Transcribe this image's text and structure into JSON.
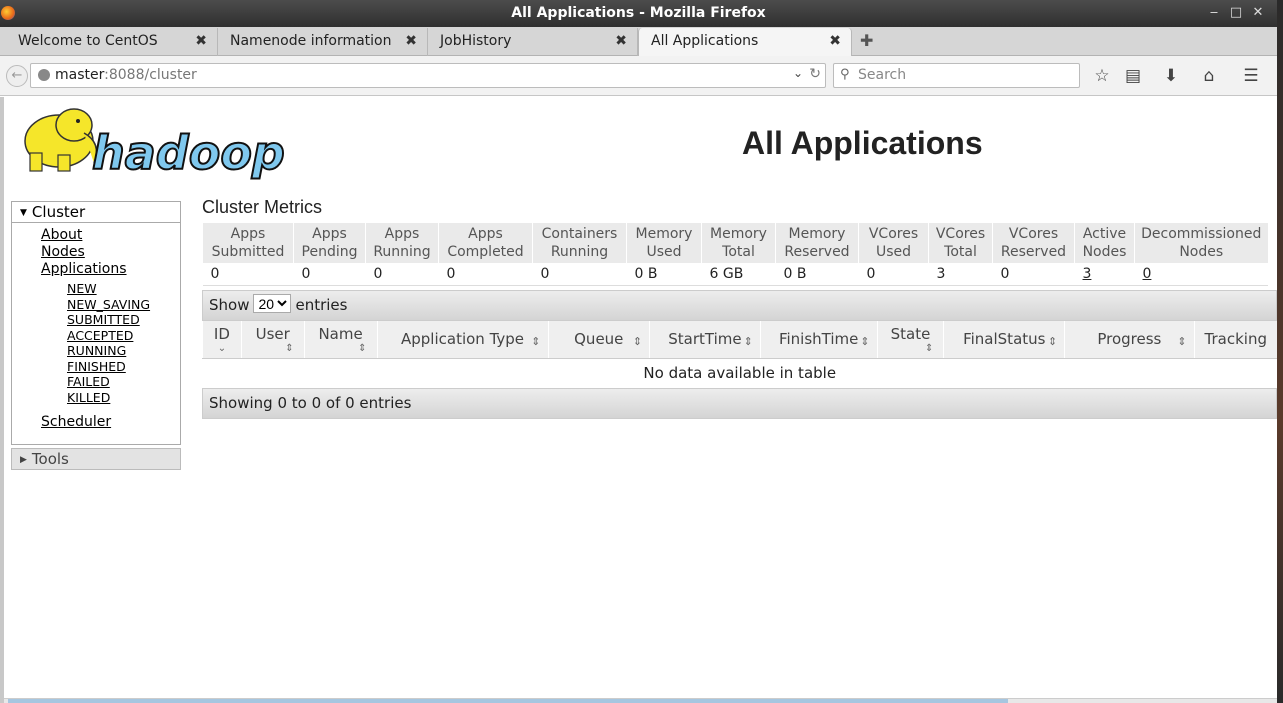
{
  "window": {
    "title": "All Applications - Mozilla Firefox"
  },
  "tabs": [
    {
      "label": "Welcome to CentOS"
    },
    {
      "label": "Namenode information"
    },
    {
      "label": "JobHistory"
    },
    {
      "label": "All Applications"
    }
  ],
  "nav": {
    "url_host": "master",
    "url_rest": ":8088/cluster",
    "search_placeholder": "Search"
  },
  "page": {
    "title": "All Applications"
  },
  "sidebar": {
    "cluster_label": "Cluster",
    "links": {
      "about": "About",
      "nodes": "Nodes",
      "applications": "Applications",
      "scheduler": "Scheduler"
    },
    "app_states": [
      "NEW",
      "NEW_SAVING",
      "SUBMITTED",
      "ACCEPTED",
      "RUNNING",
      "FINISHED",
      "FAILED",
      "KILLED"
    ],
    "tools_label": "Tools"
  },
  "metrics": {
    "title": "Cluster Metrics",
    "headers": [
      [
        "Apps",
        "Submitted"
      ],
      [
        "Apps",
        "Pending"
      ],
      [
        "Apps",
        "Running"
      ],
      [
        "Apps",
        "Completed"
      ],
      [
        "Containers",
        "Running"
      ],
      [
        "Memory",
        "Used"
      ],
      [
        "Memory",
        "Total"
      ],
      [
        "Memory",
        "Reserved"
      ],
      [
        "VCores",
        "Used"
      ],
      [
        "VCores",
        "Total"
      ],
      [
        "VCores",
        "Reserved"
      ],
      [
        "Active",
        "Nodes"
      ],
      [
        "Decommissioned",
        "Nodes"
      ]
    ],
    "values": [
      "0",
      "0",
      "0",
      "0",
      "0",
      "0 B",
      "6 GB",
      "0 B",
      "0",
      "3",
      "0",
      "3",
      "0"
    ]
  },
  "apps_table": {
    "show_label": "Show",
    "entries_label": "entries",
    "page_size": "20",
    "columns": [
      "ID",
      "User",
      "Name",
      "Application Type",
      "Queue",
      "StartTime",
      "FinishTime",
      "State",
      "FinalStatus",
      "Progress",
      "Tracking"
    ],
    "empty_message": "No data available in table",
    "info": "Showing 0 to 0 of 0 entries"
  }
}
